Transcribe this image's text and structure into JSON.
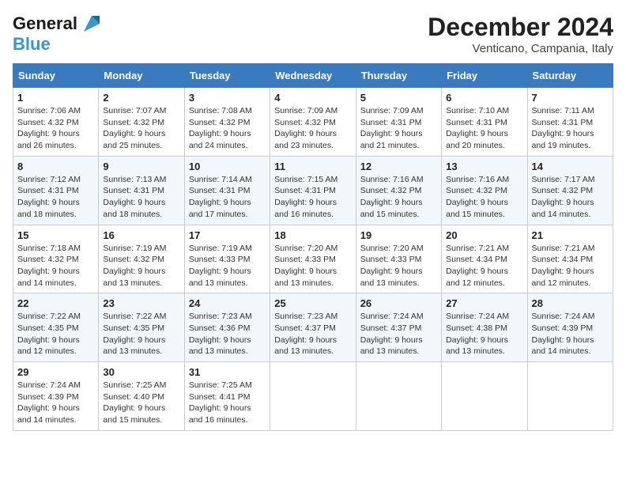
{
  "logo": {
    "line1": "General",
    "line2": "Blue"
  },
  "title": "December 2024",
  "location": "Venticano, Campania, Italy",
  "weekdays": [
    "Sunday",
    "Monday",
    "Tuesday",
    "Wednesday",
    "Thursday",
    "Friday",
    "Saturday"
  ],
  "weeks": [
    [
      {
        "day": "1",
        "sunrise": "7:06 AM",
        "sunset": "4:32 PM",
        "daylight": "9 hours and 26 minutes."
      },
      {
        "day": "2",
        "sunrise": "7:07 AM",
        "sunset": "4:32 PM",
        "daylight": "9 hours and 25 minutes."
      },
      {
        "day": "3",
        "sunrise": "7:08 AM",
        "sunset": "4:32 PM",
        "daylight": "9 hours and 24 minutes."
      },
      {
        "day": "4",
        "sunrise": "7:09 AM",
        "sunset": "4:32 PM",
        "daylight": "9 hours and 23 minutes."
      },
      {
        "day": "5",
        "sunrise": "7:09 AM",
        "sunset": "4:31 PM",
        "daylight": "9 hours and 21 minutes."
      },
      {
        "day": "6",
        "sunrise": "7:10 AM",
        "sunset": "4:31 PM",
        "daylight": "9 hours and 20 minutes."
      },
      {
        "day": "7",
        "sunrise": "7:11 AM",
        "sunset": "4:31 PM",
        "daylight": "9 hours and 19 minutes."
      }
    ],
    [
      {
        "day": "8",
        "sunrise": "7:12 AM",
        "sunset": "4:31 PM",
        "daylight": "9 hours and 18 minutes."
      },
      {
        "day": "9",
        "sunrise": "7:13 AM",
        "sunset": "4:31 PM",
        "daylight": "9 hours and 18 minutes."
      },
      {
        "day": "10",
        "sunrise": "7:14 AM",
        "sunset": "4:31 PM",
        "daylight": "9 hours and 17 minutes."
      },
      {
        "day": "11",
        "sunrise": "7:15 AM",
        "sunset": "4:31 PM",
        "daylight": "9 hours and 16 minutes."
      },
      {
        "day": "12",
        "sunrise": "7:16 AM",
        "sunset": "4:32 PM",
        "daylight": "9 hours and 15 minutes."
      },
      {
        "day": "13",
        "sunrise": "7:16 AM",
        "sunset": "4:32 PM",
        "daylight": "9 hours and 15 minutes."
      },
      {
        "day": "14",
        "sunrise": "7:17 AM",
        "sunset": "4:32 PM",
        "daylight": "9 hours and 14 minutes."
      }
    ],
    [
      {
        "day": "15",
        "sunrise": "7:18 AM",
        "sunset": "4:32 PM",
        "daylight": "9 hours and 14 minutes."
      },
      {
        "day": "16",
        "sunrise": "7:19 AM",
        "sunset": "4:32 PM",
        "daylight": "9 hours and 13 minutes."
      },
      {
        "day": "17",
        "sunrise": "7:19 AM",
        "sunset": "4:33 PM",
        "daylight": "9 hours and 13 minutes."
      },
      {
        "day": "18",
        "sunrise": "7:20 AM",
        "sunset": "4:33 PM",
        "daylight": "9 hours and 13 minutes."
      },
      {
        "day": "19",
        "sunrise": "7:20 AM",
        "sunset": "4:33 PM",
        "daylight": "9 hours and 13 minutes."
      },
      {
        "day": "20",
        "sunrise": "7:21 AM",
        "sunset": "4:34 PM",
        "daylight": "9 hours and 12 minutes."
      },
      {
        "day": "21",
        "sunrise": "7:21 AM",
        "sunset": "4:34 PM",
        "daylight": "9 hours and 12 minutes."
      }
    ],
    [
      {
        "day": "22",
        "sunrise": "7:22 AM",
        "sunset": "4:35 PM",
        "daylight": "9 hours and 12 minutes."
      },
      {
        "day": "23",
        "sunrise": "7:22 AM",
        "sunset": "4:35 PM",
        "daylight": "9 hours and 13 minutes."
      },
      {
        "day": "24",
        "sunrise": "7:23 AM",
        "sunset": "4:36 PM",
        "daylight": "9 hours and 13 minutes."
      },
      {
        "day": "25",
        "sunrise": "7:23 AM",
        "sunset": "4:37 PM",
        "daylight": "9 hours and 13 minutes."
      },
      {
        "day": "26",
        "sunrise": "7:24 AM",
        "sunset": "4:37 PM",
        "daylight": "9 hours and 13 minutes."
      },
      {
        "day": "27",
        "sunrise": "7:24 AM",
        "sunset": "4:38 PM",
        "daylight": "9 hours and 13 minutes."
      },
      {
        "day": "28",
        "sunrise": "7:24 AM",
        "sunset": "4:39 PM",
        "daylight": "9 hours and 14 minutes."
      }
    ],
    [
      {
        "day": "29",
        "sunrise": "7:24 AM",
        "sunset": "4:39 PM",
        "daylight": "9 hours and 14 minutes."
      },
      {
        "day": "30",
        "sunrise": "7:25 AM",
        "sunset": "4:40 PM",
        "daylight": "9 hours and 15 minutes."
      },
      {
        "day": "31",
        "sunrise": "7:25 AM",
        "sunset": "4:41 PM",
        "daylight": "9 hours and 16 minutes."
      },
      null,
      null,
      null,
      null
    ]
  ]
}
